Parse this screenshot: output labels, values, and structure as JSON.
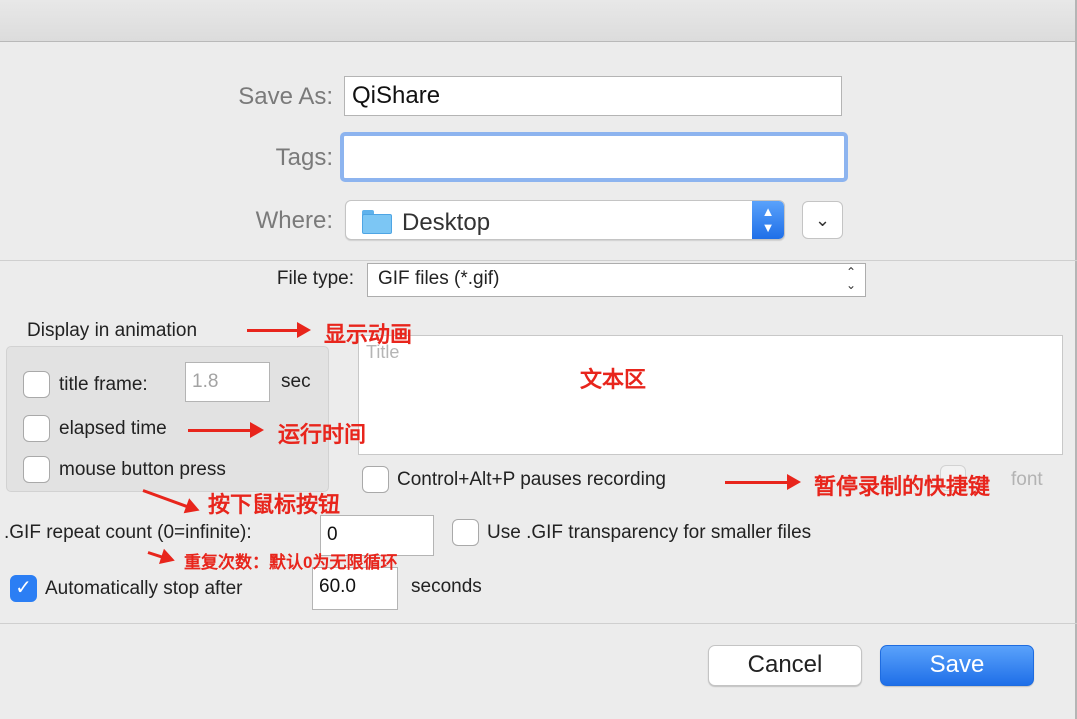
{
  "save_as": {
    "label": "Save As:",
    "value": "QiShare"
  },
  "tags": {
    "label": "Tags:",
    "value": ""
  },
  "where": {
    "label": "Where:",
    "value": "Desktop",
    "folder_icon": "folder-icon"
  },
  "file_type": {
    "label": "File type:",
    "value": "GIF files (*.gif)"
  },
  "display_in_animation": {
    "heading": "Display in animation",
    "title_frame": {
      "label": "title frame:",
      "value": "1.8",
      "unit": "sec",
      "checked": false
    },
    "elapsed_time": {
      "label": "elapsed time",
      "checked": false
    },
    "mouse_button_press": {
      "label": "mouse button press",
      "checked": false
    }
  },
  "title_text": {
    "placeholder": "Title"
  },
  "pause_hotkey": {
    "label": "Control+Alt+P pauses recording",
    "checked": false
  },
  "font_label": "font",
  "repeat": {
    "label": ".GIF repeat count (0=infinite):",
    "value": "0"
  },
  "transparency": {
    "label": "Use .GIF transparency for smaller files",
    "checked": false
  },
  "auto_stop": {
    "label": "Automatically stop after",
    "value": "60.0",
    "unit": "seconds",
    "checked": true
  },
  "buttons": {
    "cancel": "Cancel",
    "save": "Save"
  },
  "annotations": {
    "display": "显示动画",
    "text_area": "文本区",
    "elapsed": "运行时间",
    "mouse": "按下鼠标按钮",
    "pause": "暂停录制的快捷键",
    "repeat": "重复次数：默认0为无限循环"
  },
  "colors": {
    "accent": "#2b7ef4",
    "annotation": "#e8251c",
    "focus_ring": "#8db4ef"
  }
}
